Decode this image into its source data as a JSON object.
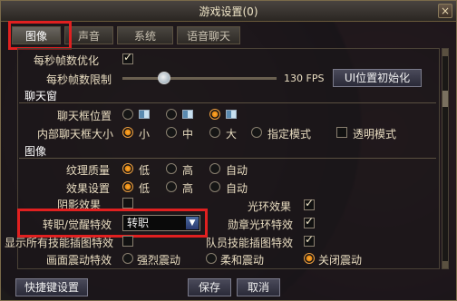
{
  "window": {
    "title": "游戏设置(0)",
    "close_glyph": "×"
  },
  "tabs": [
    {
      "label": "图像",
      "active": true
    },
    {
      "label": "声音",
      "active": false
    },
    {
      "label": "系统",
      "active": false
    },
    {
      "label": "语音聊天",
      "active": false
    }
  ],
  "framerate": {
    "optimize_label": "每秒帧数优化",
    "optimize_checked": true,
    "limit_label": "每秒帧数限制",
    "limit_value": "130 FPS",
    "limit_fraction": 0.27,
    "reset_ui_label": "UI位置初始化"
  },
  "chat_section": {
    "title": "聊天窗",
    "box_position_label": "聊天框位置",
    "box_position_selected": 2,
    "inner_size_label": "内部聊天框大小",
    "sizes": [
      "小",
      "中",
      "大"
    ],
    "size_selected": 0,
    "custom_mode_label": "指定模式",
    "transparent_mode_label": "透明模式"
  },
  "image_section": {
    "title": "图像",
    "texture_label": "纹理质量",
    "effects_label": "效果设置",
    "levels": [
      "低",
      "高",
      "自动"
    ],
    "texture_selected": 0,
    "effects_selected": 0,
    "shadow_label": "阴影效果",
    "halo_label": "光环效果",
    "halo_checked": true,
    "transfer_label": "转职/觉醒特效",
    "transfer_value": "转职",
    "medal_halo_label": "勋章光环特效",
    "medal_halo_checked": true,
    "all_skill_label": "显示所有技能插图特效",
    "all_skill_checked": false,
    "party_skill_label": "队员技能插图特效",
    "party_skill_checked": true,
    "shake_label": "画面震动特效",
    "shake_options": [
      "强烈震动",
      "柔和震动",
      "关闭震动"
    ],
    "shake_selected": 2
  },
  "footer": {
    "shortcut_label": "快捷键设置",
    "save_label": "保存",
    "cancel_label": "取消"
  }
}
